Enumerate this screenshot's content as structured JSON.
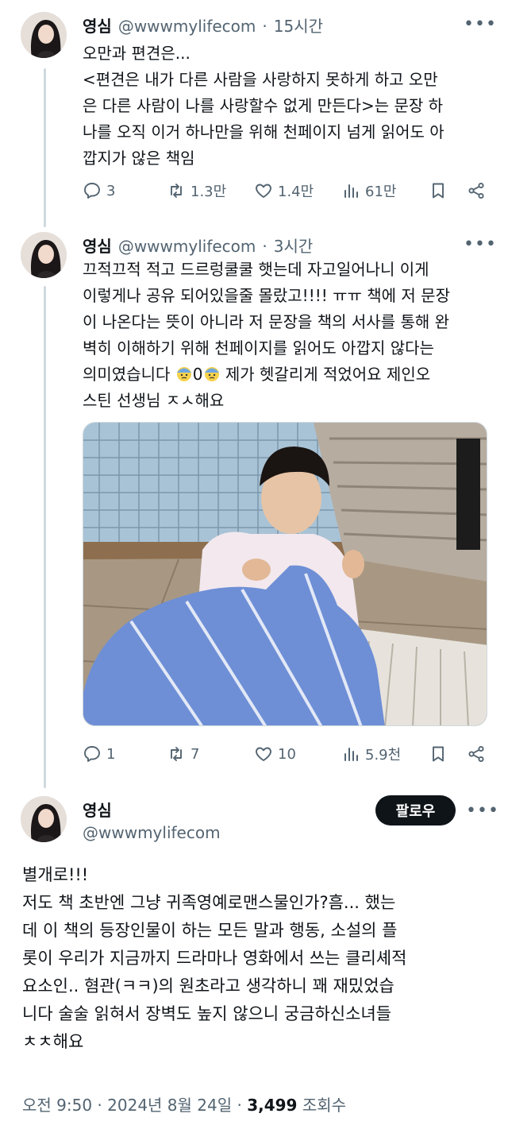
{
  "tweet1": {
    "name": "영심",
    "handle": "@wwwmylifecom",
    "dot": "·",
    "time": "15시간",
    "lines": [
      "오만과 편견은...",
      "<편견은 내가 다른 사람을 사랑하지 못하게 하고 오만",
      "은 다른 사람이 나를 사랑할수 없게 만든다>는 문장 하",
      "나를 오직 이거 하나만을 위해 천페이지 넘게 읽어도 아",
      "깝지가 않은 책임"
    ],
    "replies": "3",
    "retweets": "1.3만",
    "likes": "1.4만",
    "views": "61만"
  },
  "tweet2": {
    "name": "영심",
    "handle": "@wwwmylifecom",
    "dot": "·",
    "time": "3시간",
    "lines": [
      "끄적끄적 적고 드르렁쿨쿨 햇는데 자고일어나니 이게",
      "이렇게나 공유 되어있을줄 몰랐고!!!! ㅠㅠ 책에 저 문장",
      "이 나온다는 뜻이 아니라 저 문장을 책의 서사를 통해 완",
      "벽히 이해하기 위해 천페이지를 읽어도 아깝지 않다는"
    ],
    "line5_a": "의미였습니다",
    "line5_b": "0",
    "line5_c": "제가 헷갈리게 적었어요 제인오",
    "line6": "스틴 선생님 ㅈㅅ해요",
    "replies": "1",
    "retweets": "7",
    "likes": "10",
    "views": "5.9천"
  },
  "tweet3": {
    "name": "영심",
    "handle": "@wwwmylifecom",
    "follow_label": "팔로우",
    "lines": [
      "별개로!!!",
      "저도 책 초반엔 그냥 귀족영예로맨스물인가?흠... 했는",
      "데 이 책의 등장인물이 하는 모든 말과 행동, 소설의 플",
      "롯이 우리가 지금까지 드라마나 영화에서 쓰는 클리셰적",
      "요소인.. 혐관(ㅋㅋ)의 원초라고 생각하니 꽤 재밌었습",
      "니다 술술 읽혀서 장벽도 높지 않으니 궁금하신소녀들",
      "ㅊㅊ해요"
    ],
    "timestamp": "오전 9:50 · 2024년 8월 24일 · ",
    "view_count": "3,499",
    "view_label": " 조회수"
  },
  "icons": [
    "reply-icon",
    "retweet-icon",
    "like-icon",
    "views-icon",
    "bookmark-icon",
    "share-icon",
    "more-icon",
    "cold-sweat-emoji"
  ],
  "colors": {
    "text": "#0f1419",
    "muted": "#536471",
    "thread": "#cfd9de",
    "follow_bg": "#0f1419"
  }
}
